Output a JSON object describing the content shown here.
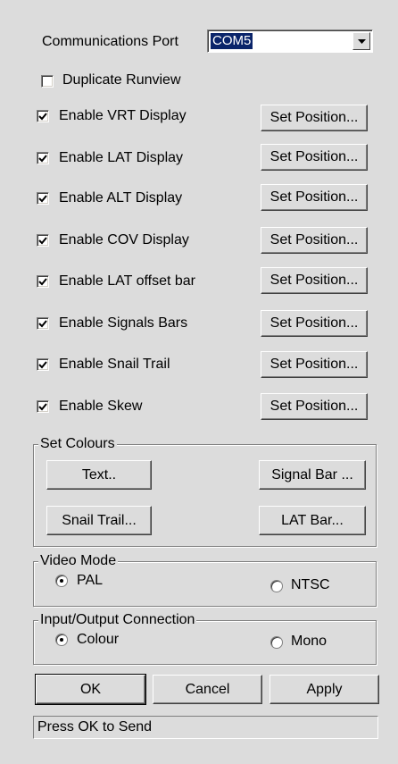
{
  "comm_port": {
    "label": "Communications Port",
    "value": "COM5"
  },
  "duplicate_runview": {
    "label": "Duplicate Runview",
    "checked": false
  },
  "displays": [
    {
      "label": "Enable VRT Display",
      "checked": true,
      "button": "Set Position..."
    },
    {
      "label": "Enable LAT Display",
      "checked": true,
      "button": "Set Position..."
    },
    {
      "label": "Enable ALT Display",
      "checked": true,
      "button": "Set Position..."
    },
    {
      "label": "Enable COV Display",
      "checked": true,
      "button": "Set Position..."
    },
    {
      "label": "Enable LAT offset bar",
      "checked": true,
      "button": "Set Position..."
    },
    {
      "label": "Enable Signals Bars",
      "checked": true,
      "button": "Set Position..."
    },
    {
      "label": "Enable Snail Trail",
      "checked": true,
      "button": "Set Position..."
    },
    {
      "label": "Enable Skew",
      "checked": true,
      "button": "Set Position..."
    }
  ],
  "set_colours": {
    "title": "Set Colours",
    "text_button": "Text..",
    "signal_bar_button": "Signal Bar ...",
    "snail_trail_button": "Snail Trail...",
    "lat_bar_button": "LAT Bar..."
  },
  "video_mode": {
    "title": "Video Mode",
    "options": [
      {
        "label": "PAL",
        "selected": true
      },
      {
        "label": "NTSC",
        "selected": false
      }
    ]
  },
  "io_connection": {
    "title": "Input/Output Connection",
    "options": [
      {
        "label": "Colour",
        "selected": true
      },
      {
        "label": "Mono",
        "selected": false
      }
    ]
  },
  "actions": {
    "ok": "OK",
    "cancel": "Cancel",
    "apply": "Apply"
  },
  "status": "Press OK to Send",
  "colors": {
    "face": "#dcdcdc",
    "selection": "#0a246a"
  }
}
